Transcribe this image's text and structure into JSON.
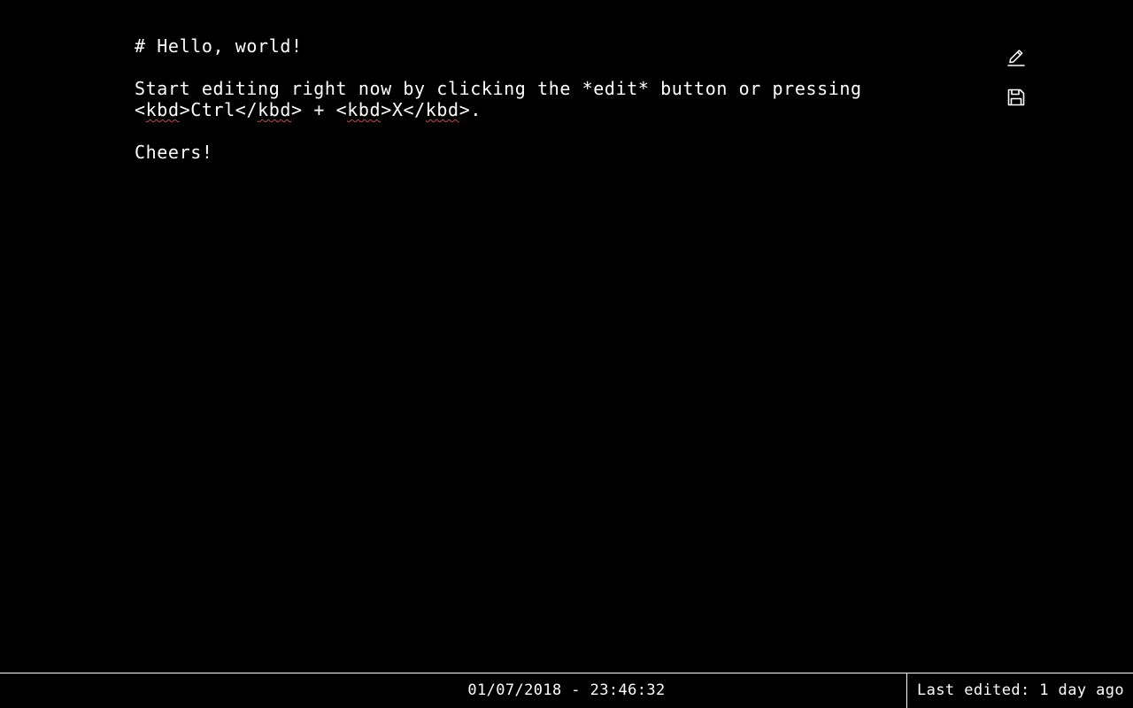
{
  "editor": {
    "lines": [
      [
        "# Hello, world!"
      ],
      [
        ""
      ],
      [
        "Start editing right now by clicking the *edit* button or pressing"
      ],
      [
        "<",
        "kbd",
        ">Ctrl</",
        "kbd",
        "> + <",
        "kbd",
        ">X</",
        "kbd",
        ">."
      ],
      [
        ""
      ],
      [
        "Cheers!"
      ]
    ]
  },
  "toolbar": {
    "edit_icon": "pencil-icon",
    "save_icon": "floppy-disk-icon"
  },
  "status": {
    "datetime": "01/07/2018 - 23:46:32",
    "last_edited": "Last edited: 1 day ago"
  },
  "colors": {
    "background": "#000000",
    "text": "#ffffff",
    "spellcheck": "#e04040"
  }
}
